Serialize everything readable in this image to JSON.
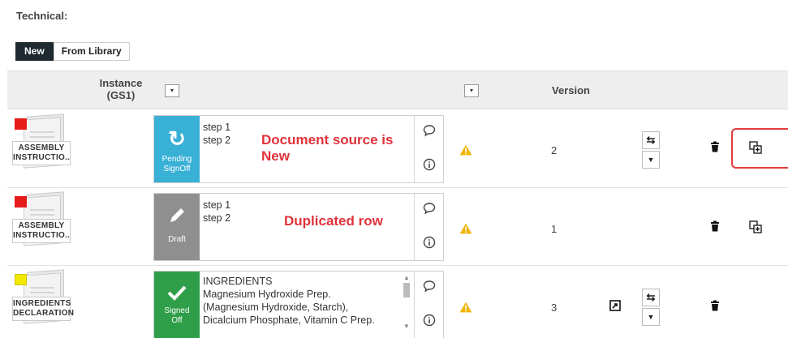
{
  "section": {
    "title": "Technical:"
  },
  "toolbar": {
    "new_label": "New",
    "library_label": "From Library"
  },
  "table": {
    "header_instance": "Instance (GS1)",
    "header_version": "Version",
    "filter_icon": "▾"
  },
  "rows": [
    {
      "doc_label": "ASSEMBLY INSTRUCTIO..",
      "doc_color": "#e81b1b",
      "status": {
        "label": "Pending SignOff",
        "color": "#39b0d6",
        "icon": "refresh-icon"
      },
      "steps": [
        "step 1",
        "step 2"
      ],
      "version": "2"
    },
    {
      "doc_label": "ASSEMBLY INSTRUCTIO..",
      "doc_color": "#e81b1b",
      "status": {
        "label": "Draft",
        "color": "#8f8f8f",
        "icon": "pencil-icon"
      },
      "steps": [
        "step 1",
        "step 2"
      ],
      "version": "1"
    },
    {
      "doc_label": "INGREDIENTS DECLARATION",
      "doc_color": "#f3e800",
      "status": {
        "label": "Signed Off",
        "color": "#2e9e48",
        "icon": "check-icon"
      },
      "steps": [
        "INGREDIENTS",
        "Magnesium Hydroxide Prep.",
        "(Magnesium Hydroxide, Starch),",
        "Dicalcium Phosphate, Vitamin C Prep."
      ],
      "version": "3"
    }
  ],
  "annotations": {
    "source_new": "Document source is New",
    "duplicated": "Duplicated row"
  },
  "colors": {
    "highlight": "#e23c3c",
    "warning": "#f0b400"
  }
}
